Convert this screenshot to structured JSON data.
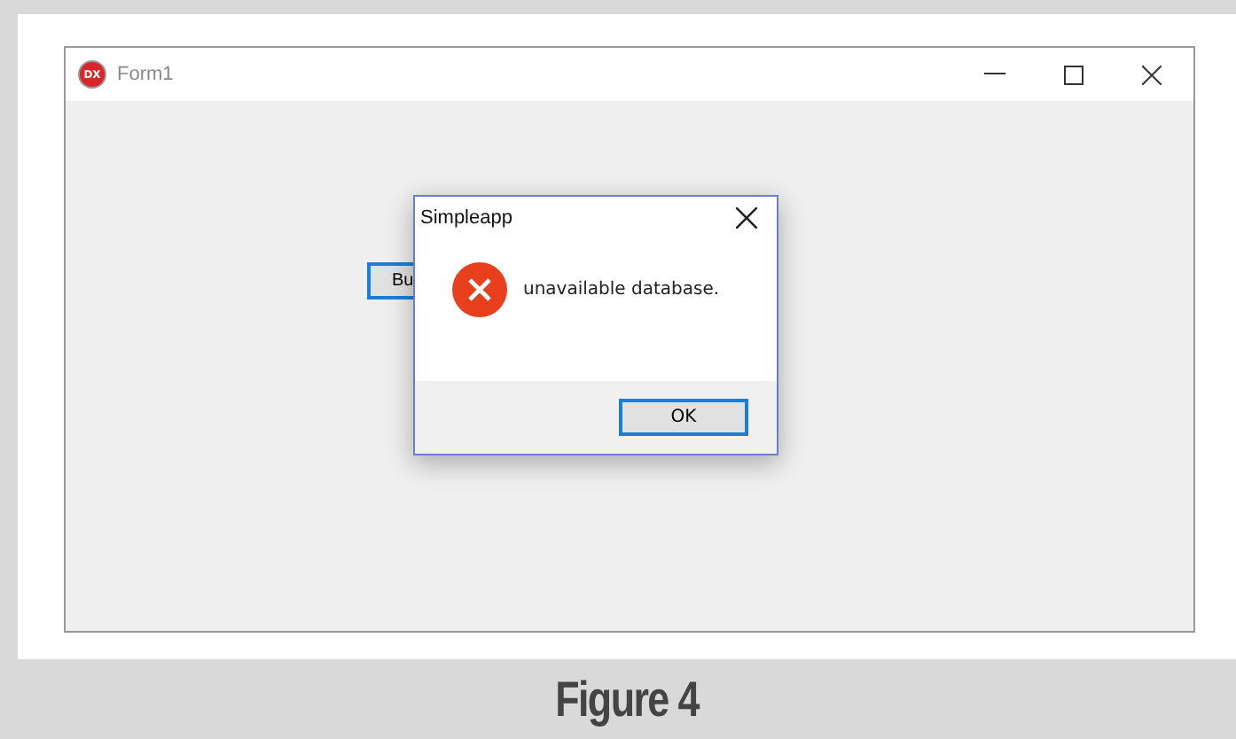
{
  "window": {
    "title": "Form1",
    "icon_text": "DX"
  },
  "form": {
    "button": "Bu"
  },
  "dialog": {
    "title": "Simpleapp",
    "message": "unavailable database.",
    "buttons": [
      "OK"
    ]
  },
  "caption": "Figure 4"
}
